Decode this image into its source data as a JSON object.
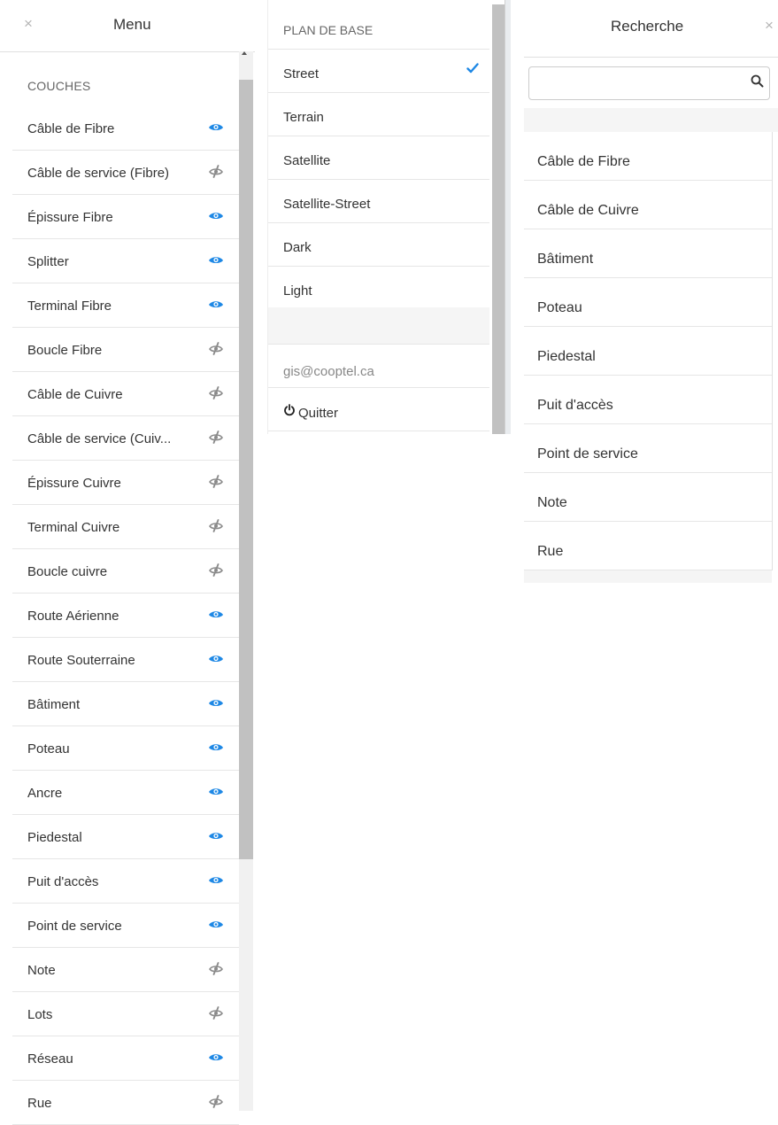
{
  "menu": {
    "title": "Menu",
    "close_glyph": "×",
    "section_label": "COUCHES",
    "layers": [
      {
        "label": "Câble de Fibre",
        "visible": true
      },
      {
        "label": "Câble de service (Fibre)",
        "visible": false
      },
      {
        "label": "Épissure Fibre",
        "visible": true
      },
      {
        "label": "Splitter",
        "visible": true
      },
      {
        "label": "Terminal Fibre",
        "visible": true
      },
      {
        "label": "Boucle Fibre",
        "visible": false
      },
      {
        "label": "Câble de Cuivre",
        "visible": false
      },
      {
        "label": "Câble de service (Cuiv...",
        "visible": false
      },
      {
        "label": "Épissure Cuivre",
        "visible": false
      },
      {
        "label": "Terminal Cuivre",
        "visible": false
      },
      {
        "label": "Boucle cuivre",
        "visible": false
      },
      {
        "label": "Route Aérienne",
        "visible": true
      },
      {
        "label": "Route Souterraine",
        "visible": true
      },
      {
        "label": "Bâtiment",
        "visible": true
      },
      {
        "label": "Poteau",
        "visible": true
      },
      {
        "label": "Ancre",
        "visible": true
      },
      {
        "label": "Piedestal",
        "visible": true
      },
      {
        "label": "Puit d'accès",
        "visible": true
      },
      {
        "label": "Point de service",
        "visible": true
      },
      {
        "label": "Note",
        "visible": false
      },
      {
        "label": "Lots",
        "visible": false
      },
      {
        "label": "Réseau",
        "visible": true
      },
      {
        "label": "Rue",
        "visible": false
      }
    ]
  },
  "basemap": {
    "title": "PLAN DE BASE",
    "options": [
      {
        "label": "Street",
        "selected": true
      },
      {
        "label": "Terrain",
        "selected": false
      },
      {
        "label": "Satellite",
        "selected": false
      },
      {
        "label": "Satellite-Street",
        "selected": false
      },
      {
        "label": "Dark",
        "selected": false
      },
      {
        "label": "Light",
        "selected": false
      }
    ],
    "user_email": "gis@cooptel.ca",
    "quit_label": "Quitter"
  },
  "search": {
    "title": "Recherche",
    "close_glyph": "×",
    "input_value": "",
    "input_placeholder": "",
    "results": [
      "Câble de Fibre",
      "Câble de Cuivre",
      "Bâtiment",
      "Poteau",
      "Piedestal",
      "Puit d'accès",
      "Point de service",
      "Note",
      "Rue"
    ]
  },
  "colors": {
    "accent": "#1e88e5",
    "icon_muted": "#8a8a8a",
    "text": "#333333",
    "divider": "#e6e6e6"
  },
  "icons": {
    "visible": "eye-icon",
    "hidden": "eye-slash-icon",
    "selected": "check-icon",
    "quit": "power-icon",
    "search": "search-icon",
    "close": "close-icon"
  }
}
